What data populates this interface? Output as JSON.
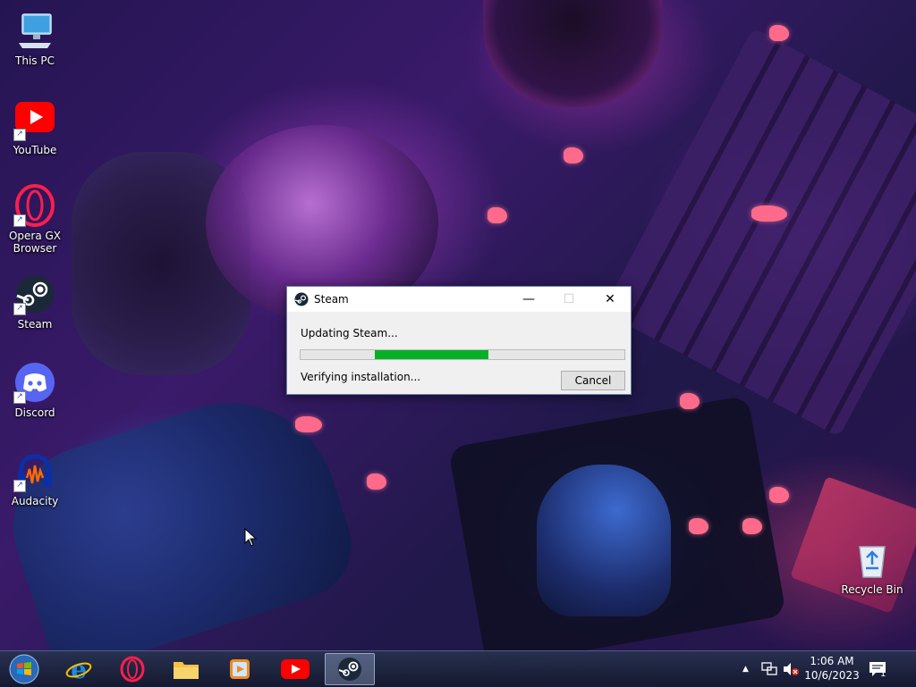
{
  "desktop": {
    "icons": [
      {
        "label": "This PC"
      },
      {
        "label": "YouTube"
      },
      {
        "label": "Opera GX Browser"
      },
      {
        "label": "Steam"
      },
      {
        "label": "Discord"
      },
      {
        "label": "Audacity"
      },
      {
        "label": "Recycle Bin"
      }
    ]
  },
  "dialog": {
    "title": "Steam",
    "status": "Updating Steam...",
    "detail": "Verifying installation...",
    "cancel_label": "Cancel",
    "minimize_glyph": "—",
    "maximize_glyph": "☐",
    "close_glyph": "✕",
    "progress": {
      "start_fraction": 0.23,
      "end_fraction": 0.58,
      "color": "#06b025"
    }
  },
  "taskbar": {
    "items": [
      {
        "name": "start-button"
      },
      {
        "name": "internet-explorer"
      },
      {
        "name": "opera-gx"
      },
      {
        "name": "file-explorer"
      },
      {
        "name": "media-player"
      },
      {
        "name": "youtube"
      },
      {
        "name": "steam",
        "active": true
      }
    ],
    "tray": {
      "show_hidden": "▲",
      "time": "1:06 AM",
      "date": "10/6/2023",
      "notifications_count": "1"
    }
  }
}
